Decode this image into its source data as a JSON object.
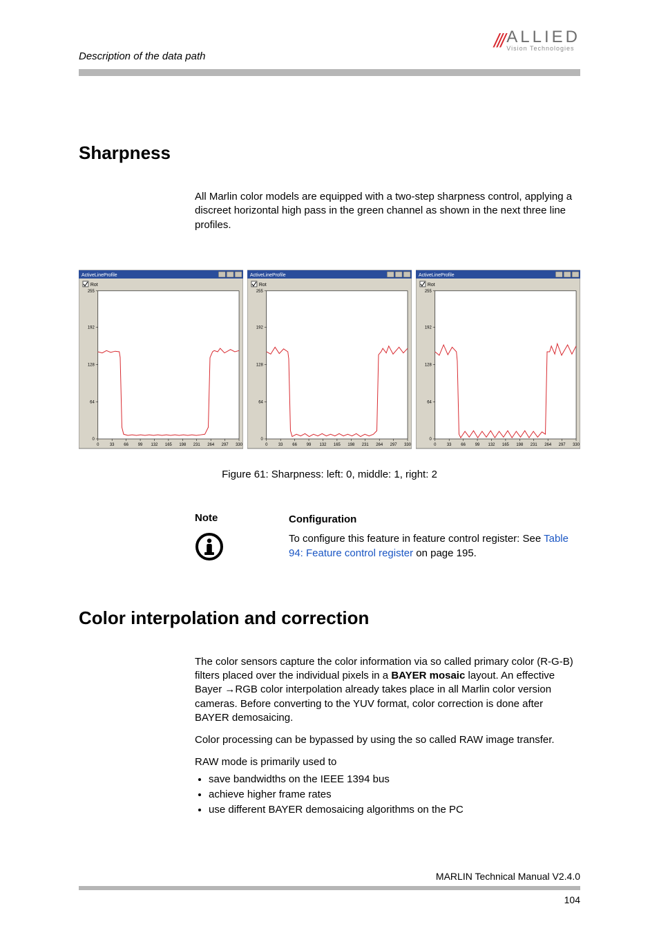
{
  "header": {
    "breadcrumb": "Description of the data path",
    "logo_main": "ALLIED",
    "logo_sub": "Vision Technologies"
  },
  "section1": {
    "title": "Sharpness",
    "body": "All Marlin color models are equipped with a two-step sharpness control, applying a discreet horizontal high pass in the green channel as shown in the next three line profiles.",
    "caption": "Figure 61: Sharpness: left: 0, middle: 1, right: 2"
  },
  "note": {
    "label": "Note",
    "subhead": "Configuration",
    "lead": "To configure this feature in feature control register: See ",
    "link": "Table 94: Feature control register",
    "tail": " on page 195."
  },
  "section2": {
    "title": "Color interpolation and correction",
    "p1a": "The color sensors capture the color information via so called primary color (R-G-B) filters placed over the individual pixels in a ",
    "p1b_bold": "BAYER mosaic",
    "p1c": " layout. An effective Bayer",
    "p1d": "RGB color interpolation already takes place in all Marlin color version cameras. Before converting to the YUV format, color correction is done after BAYER demosaicing.",
    "p2": "Color processing can be bypassed by using the so called RAW image transfer.",
    "p3": "RAW mode is primarily used to",
    "bullets": [
      "save bandwidths on the IEEE 1394 bus",
      "achieve higher frame rates",
      "use different BAYER demosaicing algorithms on the PC"
    ]
  },
  "footer": {
    "manual": "MARLIN Technical Manual V2.4.0",
    "page": "104"
  },
  "chart_data": [
    {
      "type": "line",
      "title": "ActiveLineProfile",
      "xlabel": "",
      "ylabel": "",
      "xlim": [
        0,
        330
      ],
      "ylim": [
        0,
        255
      ],
      "xticks": [
        0,
        33,
        66,
        99,
        132,
        165,
        198,
        231,
        264,
        297,
        330
      ],
      "yticks": [
        0,
        64,
        128,
        192,
        255
      ],
      "series": [
        {
          "name": "Rot",
          "color": "#d8292f",
          "x": [
            0,
            10,
            20,
            30,
            40,
            50,
            52,
            56,
            60,
            70,
            80,
            90,
            100,
            110,
            120,
            130,
            140,
            150,
            160,
            170,
            180,
            190,
            200,
            210,
            220,
            230,
            240,
            250,
            258,
            262,
            268,
            272,
            280,
            286,
            296,
            310,
            320,
            330
          ],
          "values": [
            150,
            148,
            152,
            149,
            151,
            150,
            140,
            20,
            8,
            6,
            7,
            6,
            7,
            6,
            7,
            6,
            7,
            6,
            7,
            6,
            7,
            6,
            7,
            6,
            7,
            6,
            7,
            8,
            20,
            140,
            150,
            152,
            150,
            156,
            148,
            154,
            150,
            152
          ]
        }
      ]
    },
    {
      "type": "line",
      "title": "ActiveLineProfile",
      "xlabel": "",
      "ylabel": "",
      "xlim": [
        0,
        330
      ],
      "ylim": [
        0,
        255
      ],
      "xticks": [
        0,
        33,
        66,
        99,
        132,
        165,
        198,
        231,
        264,
        297,
        330
      ],
      "yticks": [
        0,
        64,
        128,
        192,
        255
      ],
      "series": [
        {
          "name": "Rot",
          "color": "#d8292f",
          "x": [
            0,
            10,
            20,
            30,
            40,
            50,
            52,
            56,
            60,
            70,
            80,
            90,
            100,
            110,
            120,
            130,
            140,
            150,
            160,
            170,
            180,
            190,
            200,
            210,
            220,
            230,
            240,
            250,
            258,
            262,
            268,
            272,
            280,
            286,
            296,
            310,
            320,
            330
          ],
          "values": [
            150,
            146,
            158,
            147,
            155,
            150,
            138,
            14,
            4,
            8,
            5,
            9,
            4,
            8,
            5,
            9,
            5,
            8,
            5,
            9,
            5,
            8,
            5,
            9,
            4,
            8,
            5,
            8,
            14,
            145,
            150,
            156,
            148,
            160,
            146,
            158,
            148,
            156
          ]
        }
      ]
    },
    {
      "type": "line",
      "title": "ActiveLineProfile",
      "xlabel": "",
      "ylabel": "",
      "xlim": [
        0,
        330
      ],
      "ylim": [
        0,
        255
      ],
      "xticks": [
        0,
        33,
        66,
        99,
        132,
        165,
        198,
        231,
        264,
        297,
        330
      ],
      "yticks": [
        0,
        64,
        128,
        192,
        255
      ],
      "series": [
        {
          "name": "Rot",
          "color": "#d8292f",
          "x": [
            0,
            10,
            20,
            30,
            40,
            50,
            52,
            56,
            60,
            70,
            80,
            90,
            100,
            110,
            120,
            130,
            140,
            150,
            160,
            170,
            180,
            190,
            200,
            210,
            220,
            230,
            240,
            250,
            258,
            262,
            268,
            272,
            280,
            286,
            296,
            310,
            320,
            330
          ],
          "values": [
            150,
            144,
            162,
            145,
            158,
            150,
            134,
            8,
            2,
            13,
            3,
            14,
            2,
            13,
            3,
            14,
            2,
            13,
            3,
            14,
            2,
            13,
            3,
            14,
            2,
            13,
            3,
            12,
            8,
            150,
            150,
            160,
            146,
            164,
            144,
            162,
            146,
            160
          ]
        }
      ]
    }
  ]
}
